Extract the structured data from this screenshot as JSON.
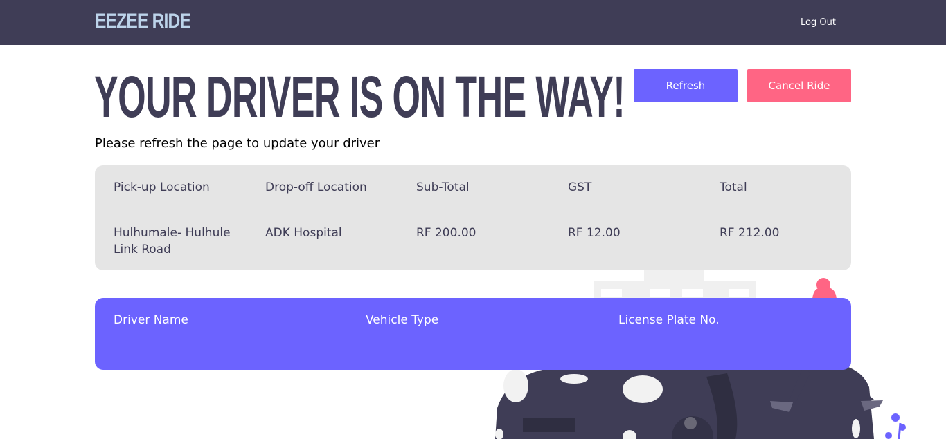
{
  "nav": {
    "logo": "EEZEE RIDE",
    "logout": "Log Out"
  },
  "main": {
    "headline": "YOUR DRIVER IS ON THE WAY!",
    "subtitle": "Please refresh the page to update your driver",
    "refresh_label": "Refresh",
    "cancel_label": "Cancel Ride"
  },
  "ride": {
    "headers": [
      "Pick-up Location",
      "Drop-off Location",
      "Sub-Total",
      "GST",
      "Total"
    ],
    "values": [
      "Hulhumale- Hulhule Link Road",
      "ADK Hospital",
      "RF 200.00",
      "RF 12.00",
      "RF 212.00"
    ]
  },
  "driver": {
    "headers": [
      "Driver Name",
      "Vehicle Type",
      "License Plate No."
    ]
  },
  "colors": {
    "navbar": "#3f3d56",
    "primary": "#6c63ff",
    "danger": "#ff6584",
    "card": "#e5e5e5"
  }
}
